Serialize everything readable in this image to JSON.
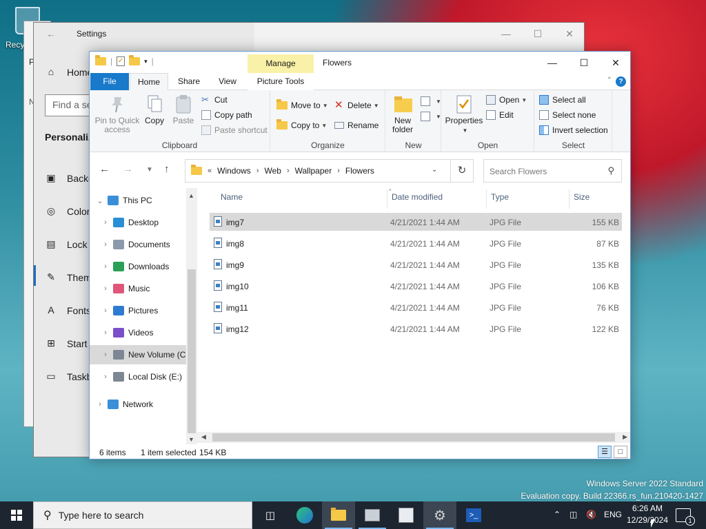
{
  "desktop": {
    "recycle_label": "Recy"
  },
  "back_window": {
    "label": "P",
    "label2": "N"
  },
  "settings": {
    "title": "Settings",
    "nav_home": "Home",
    "find_placeholder": "Find a se",
    "section": "Personaliz",
    "items": [
      {
        "label": "Backg",
        "icon": "image-icon"
      },
      {
        "label": "Color",
        "icon": "palette-icon"
      },
      {
        "label": "Lock s",
        "icon": "lock-screen-icon"
      },
      {
        "label": "Them",
        "icon": "brush-icon"
      },
      {
        "label": "Fonts",
        "icon": "fonts-icon"
      },
      {
        "label": "Start",
        "icon": "start-icon"
      },
      {
        "label": "Taskb",
        "icon": "taskbar-icon"
      }
    ]
  },
  "explorer": {
    "title": "Flowers",
    "manage_tab": "Manage",
    "tabs": [
      "File",
      "Home",
      "Share",
      "View",
      "Picture Tools"
    ],
    "ribbon": {
      "clipboard": {
        "group": "Clipboard",
        "pin": "Pin to Quick access",
        "copy": "Copy",
        "paste": "Paste",
        "cut": "Cut",
        "copy_path": "Copy path",
        "paste_shortcut": "Paste shortcut"
      },
      "organize": {
        "group": "Organize",
        "move_to": "Move to",
        "copy_to": "Copy to",
        "delete": "Delete",
        "rename": "Rename"
      },
      "new": {
        "group": "New",
        "new_folder": "New folder"
      },
      "open": {
        "group": "Open",
        "properties": "Properties",
        "open": "Open",
        "edit": "Edit"
      },
      "select": {
        "group": "Select",
        "select_all": "Select all",
        "select_none": "Select none",
        "invert": "Invert selection"
      }
    },
    "address": {
      "overflow": "«",
      "crumbs": [
        "Windows",
        "Web",
        "Wallpaper",
        "Flowers"
      ],
      "search_placeholder": "Search Flowers"
    },
    "tree": [
      {
        "label": "This PC",
        "icon": "computer-icon",
        "level": 0,
        "expanded": true
      },
      {
        "label": "Desktop",
        "icon": "desktop-icon",
        "level": 1
      },
      {
        "label": "Documents",
        "icon": "documents-icon",
        "level": 1
      },
      {
        "label": "Downloads",
        "icon": "downloads-icon",
        "level": 1
      },
      {
        "label": "Music",
        "icon": "music-icon",
        "level": 1
      },
      {
        "label": "Pictures",
        "icon": "pictures-icon",
        "level": 1
      },
      {
        "label": "Videos",
        "icon": "videos-icon",
        "level": 1
      },
      {
        "label": "New Volume (C",
        "icon": "drive-icon",
        "level": 1,
        "selected": true
      },
      {
        "label": "Local Disk (E:)",
        "icon": "drive-icon",
        "level": 1
      },
      {
        "label": "Network",
        "icon": "network-icon",
        "level": 0
      }
    ],
    "columns": [
      "Name",
      "Date modified",
      "Type",
      "Size"
    ],
    "files": [
      {
        "name": "img7",
        "date": "4/21/2021 1:44 AM",
        "type": "JPG File",
        "size": "155 KB",
        "selected": true
      },
      {
        "name": "img8",
        "date": "4/21/2021 1:44 AM",
        "type": "JPG File",
        "size": "87 KB"
      },
      {
        "name": "img9",
        "date": "4/21/2021 1:44 AM",
        "type": "JPG File",
        "size": "135 KB"
      },
      {
        "name": "img10",
        "date": "4/21/2021 1:44 AM",
        "type": "JPG File",
        "size": "106 KB"
      },
      {
        "name": "img11",
        "date": "4/21/2021 1:44 AM",
        "type": "JPG File",
        "size": "76 KB"
      },
      {
        "name": "img12",
        "date": "4/21/2021 1:44 AM",
        "type": "JPG File",
        "size": "122 KB"
      }
    ],
    "status": {
      "count": "6 items",
      "selected": "1 item selected",
      "size": "154 KB"
    }
  },
  "watermark": {
    "line1": "Windows Server 2022 Standard",
    "line2": "Evaluation copy. Build 22366.rs_fun.210420-1427"
  },
  "taskbar": {
    "search_placeholder": "Type here to search",
    "language": "ENG",
    "time": "6:26 AM",
    "date": "12/29/2024",
    "notification_count": "1"
  }
}
